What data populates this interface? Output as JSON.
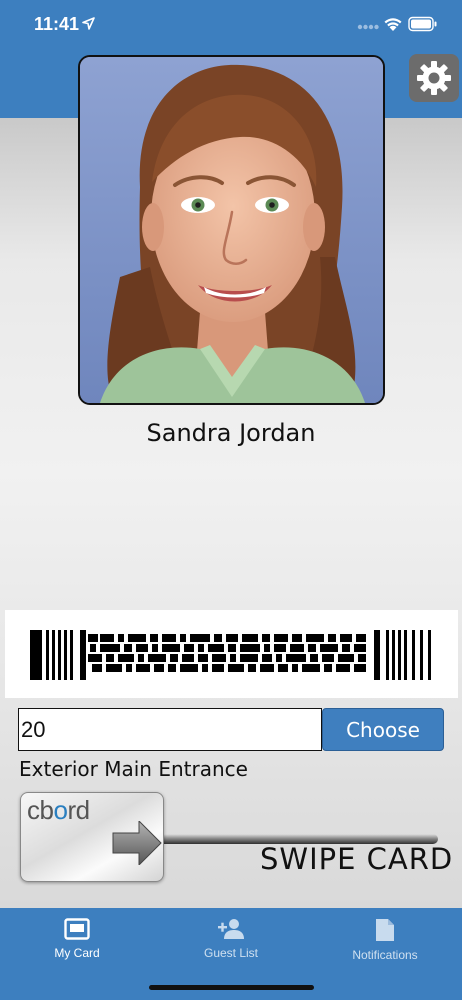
{
  "status_bar": {
    "time": "11:41"
  },
  "profile": {
    "name": "Sandra Jordan",
    "photo_alt": "ID photo"
  },
  "door": {
    "value": "20",
    "choose_label": "Choose",
    "location": "Exterior Main Entrance"
  },
  "swipe": {
    "brand_prefix": "cb",
    "brand_o": "o",
    "brand_suffix": "rd",
    "label": "SWIPE  CARD"
  },
  "tabs": [
    {
      "label": "My Card",
      "icon": "card-icon",
      "active": true
    },
    {
      "label": "Guest List",
      "icon": "add-person-icon",
      "active": false
    },
    {
      "label": "Notifications",
      "icon": "document-icon",
      "active": false
    }
  ],
  "colors": {
    "brand_blue": "#3d7fbf",
    "gear_gray": "#6c6c6c"
  }
}
